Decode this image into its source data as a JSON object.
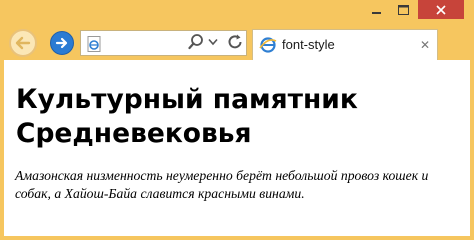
{
  "window": {
    "controls": {
      "minimize_icon": "minimize-icon",
      "maximize_icon": "maximize-icon",
      "close_icon": "close-icon"
    }
  },
  "tab": {
    "title": "font-style",
    "close_label": "✕"
  },
  "page": {
    "heading": "Культурный памятник Средневековья",
    "paragraph": "Амазонская низменность неумеренно берёт небольшой провоз кошек и собак, а Хайош-Байа славится красными винами."
  },
  "colors": {
    "frame": "#f6c65f",
    "close_button": "#c7443a",
    "forward_button": "#2b7bd3"
  }
}
